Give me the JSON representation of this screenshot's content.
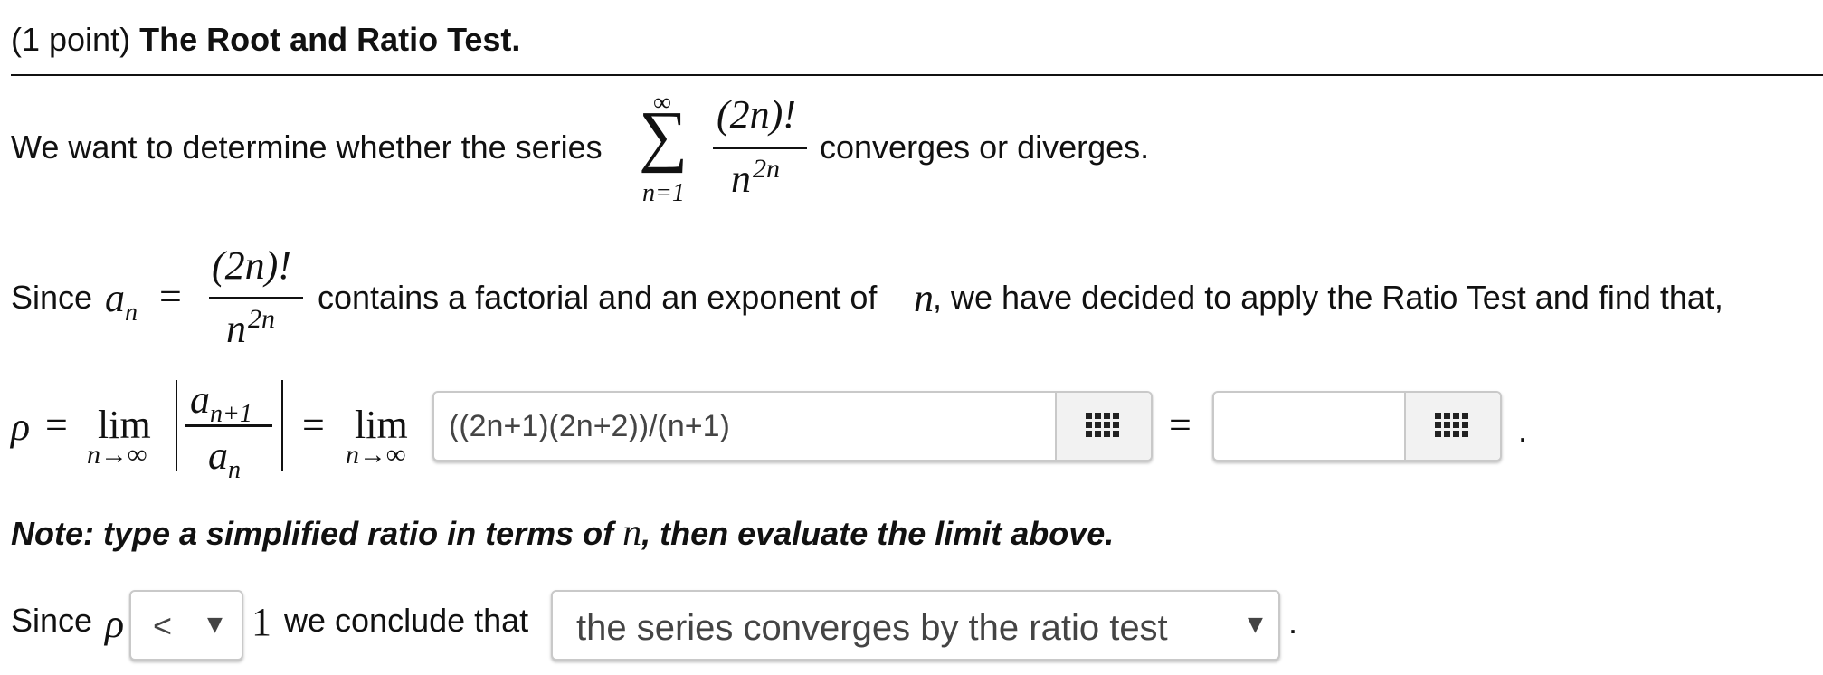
{
  "header": {
    "points": "(1 point)",
    "title": "The Root and Ratio Test."
  },
  "intro": {
    "text_before": "We want to determine whether the series",
    "sum_upper": "∞",
    "sum_symbol": "∑",
    "sum_lower": "n=1",
    "numerator": "(2n)!",
    "denominator_base": "n",
    "denominator_exp": "2n",
    "text_after": "converges or diverges."
  },
  "since_line": {
    "since": "Since",
    "a_var": "a",
    "a_sub": "n",
    "equals": "=",
    "numerator": "(2n)!",
    "denominator_base": "n",
    "denominator_exp": "2n",
    "text_mid": "contains a factorial and an exponent of",
    "n_var": "n",
    "text_end": ", we have decided to apply the Ratio Test and find that,"
  },
  "ratio_line": {
    "rho": "ρ",
    "equals": "=",
    "lim": "lim",
    "lim_sub": "n→∞",
    "frac_num_base": "a",
    "frac_num_sub": "n+1",
    "frac_den_base": "a",
    "frac_den_sub": "n",
    "ratio_input_value": "((2n+1)(2n+2))/(n+1)",
    "limit_input_value": "",
    "period": "."
  },
  "note": {
    "before": "Note: type a simplified ratio in terms of",
    "var": "n",
    "after": ", then evaluate the limit above."
  },
  "conclusion": {
    "since": "Since",
    "rho": "ρ",
    "comparison_selected": "<",
    "one": "1",
    "mid": "we conclude that",
    "conclusion_selected": "the series converges by the ratio test",
    "period": "."
  },
  "icons": {
    "palette": "grid-icon",
    "dropdown": "down-triangle-icon"
  }
}
